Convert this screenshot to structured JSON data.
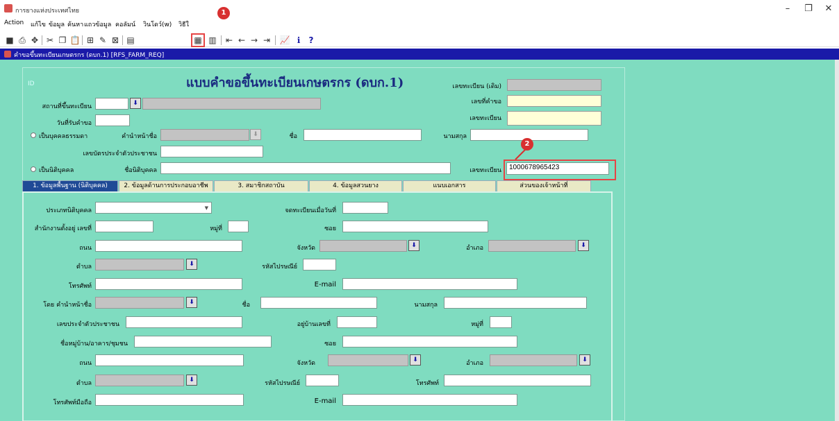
{
  "window": {
    "title": "การยางแห่งประเทศไทย",
    "minimize": "–",
    "maximize": "❐",
    "close": "✕"
  },
  "menu": [
    "Action",
    "แก้ไข",
    "ข้อมูล",
    "ค้นหา",
    "แถวข้อมูล",
    "คอลัมน์",
    "วินโดว์(w)",
    "วิธีใ"
  ],
  "form_window": {
    "title": "คำขอขึ้นทะเบียนเกษตรกร (ดบก.1) [RFS_FARM_REQ]"
  },
  "annotations": {
    "badge1": "1",
    "badge2": "2"
  },
  "header": {
    "id_label": "ID",
    "title": "แบบคำขอขึ้นทะเบียนเกษตรกร (ดบก.1)",
    "old_reg_label": "เลขทะเบียน (เดิม)",
    "request_no_label": "เลขที่คำขอ",
    "reg_no_label": "เลขทะเบียน",
    "place_label": "สถานที่ขึ้นทะเบียน",
    "recv_date_label": "วันที่รับคำขอ",
    "person_label": "เป็นบุคคลธรรมดา",
    "prefix_label": "คำนำหน้าชื่อ",
    "name_label": "ชื่อ",
    "surname_label": "นามสกุล",
    "citizen_id_label": "เลขบัตรประจำตัวประชาชน",
    "juristic_label": "เป็นนิติบุคคล",
    "juristic_name_label": "ชื่อนิติบุคคล",
    "juristic_reg_label": "เลขทะเบียน",
    "juristic_reg_value": "1000678965423"
  },
  "tabs": [
    "1. ข้อมูลพื้นฐาน (นิติบุคคล)",
    "2. ข้อมูลด้านการประกอบอาชีพ",
    "3. สมาชิกสถาบัน",
    "4. ข้อมูลสวนยาง",
    "แนบเอกสาร",
    "ส่วนของเจ้าหน้าที่"
  ],
  "tab1": {
    "juristic_type": "ประเภทนิติบุคคล",
    "reg_date": "จดทะเบียนเมื่อวันที่",
    "office_addr": "สำนักงานตั้งอยู่ เลขที่",
    "moo": "หมู่ที่",
    "soi": "ซอย",
    "road": "ถนน",
    "province": "จังหวัด",
    "district": "อำเภอ",
    "subdistrict": "ตำบล",
    "postcode": "รหัสไปรษณีย์",
    "phone": "โทรศัพท์",
    "email": "E-mail",
    "by_prefix": "โดย คำนำหน้าชื่อ",
    "name": "ชื่อ",
    "surname": "นามสกุล",
    "citizen_id": "เลขประจำตัวประชาชน",
    "house_no": "อยู่บ้านเลขที่",
    "moo2": "หมู่ที่",
    "village": "ชื่อหมู่บ้าน/อาคาร/ชุมชน",
    "soi2": "ซอย",
    "road2": "ถนน",
    "province2": "จังหวัด",
    "district2": "อำเภอ",
    "subdistrict2": "ตำบล",
    "postcode2": "รหัสไปรษณีย์",
    "phone2": "โทรศัพท์",
    "mobile": "โทรศัพท์มือถือ",
    "email2": "E-mail"
  },
  "toolbar": [
    "save-icon",
    "print-icon",
    "exit-icon",
    "cut-icon",
    "copy-icon",
    "paste-icon",
    "insert-record-icon",
    "edit-icon",
    "delete-record-icon",
    "query-icon",
    "execute-query-icon",
    "cancel-query-icon",
    "first-record-icon",
    "prev-record-icon",
    "next-record-icon",
    "last-record-icon",
    "chart-icon",
    "info-icon",
    "help-icon"
  ]
}
